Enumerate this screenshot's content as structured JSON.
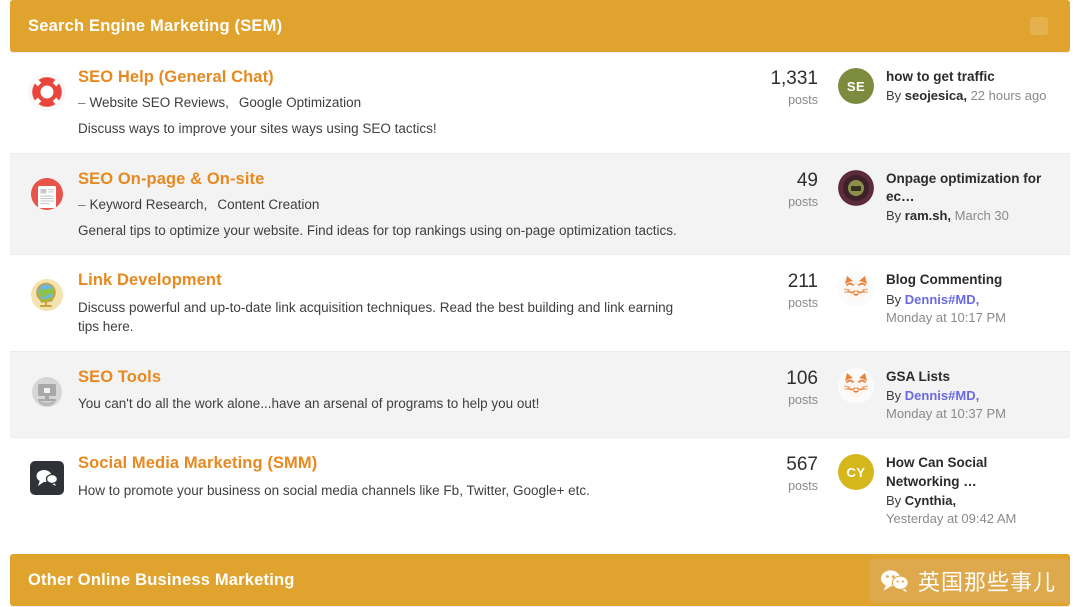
{
  "categories": [
    {
      "id": "sem",
      "title": "Search Engine Marketing (SEM)",
      "collapse_icon": "collapse-box-icon",
      "accent": "#e0a32e"
    },
    {
      "id": "other-online",
      "title": "Other Online Business Marketing",
      "collapse_icon": "collapse-box-icon",
      "accent": "#e0a32e"
    }
  ],
  "forums": [
    {
      "icon": "lifebuoy-icon",
      "title": "SEO Help (General Chat)",
      "dash": "–",
      "subforums": [
        "Website SEO Reviews,",
        "Google Optimization"
      ],
      "description": "Discuss ways to improve your sites ways using SEO tactics!",
      "count": "1,331",
      "count_label": "posts",
      "avatar": {
        "type": "initials",
        "text": "SE",
        "color": "#7d8b3f"
      },
      "last_title": "how to get traffic",
      "by_label": "By",
      "author": "seojesica,",
      "author_is_link": false,
      "time": "22 hours ago",
      "time_on_new_line": false
    },
    {
      "icon": "document-circle-icon",
      "title": "SEO On-page & On-site",
      "dash": "–",
      "subforums": [
        "Keyword Research,",
        "Content Creation"
      ],
      "description": "General tips to optimize your website. Find ideas for top rankings using on-page optimization tactics.",
      "count": "49",
      "count_label": "posts",
      "avatar": {
        "type": "badge",
        "text": "",
        "color": "#5b2c3a"
      },
      "last_title": "Onpage optimization for ec…",
      "by_label": "By",
      "author": "ram.sh,",
      "author_is_link": false,
      "time": "March 30",
      "time_on_new_line": false
    },
    {
      "icon": "globe-icon",
      "title": "Link Development",
      "dash": "",
      "subforums": [],
      "description": "Discuss powerful and up-to-date link acquisition techniques. Read the best building and link earning tips here.",
      "count": "211",
      "count_label": "posts",
      "avatar": {
        "type": "cat",
        "text": "",
        "color": "#f2f2f2"
      },
      "last_title": "Blog Commenting",
      "by_label": "By",
      "author": "Dennis#MD,",
      "author_is_link": true,
      "time": "Monday at 10:17 PM",
      "time_on_new_line": true
    },
    {
      "icon": "monitor-icon",
      "title": "SEO Tools",
      "dash": "",
      "subforums": [],
      "description": "You can't do all the work alone...have an arsenal of programs to help you out!",
      "count": "106",
      "count_label": "posts",
      "avatar": {
        "type": "cat",
        "text": "",
        "color": "#f2f2f2"
      },
      "last_title": "GSA Lists",
      "by_label": "By",
      "author": "Dennis#MD,",
      "author_is_link": true,
      "time": "Monday at 10:37 PM",
      "time_on_new_line": true
    },
    {
      "icon": "speech-bubbles-icon",
      "title": "Social Media Marketing (SMM)",
      "dash": "",
      "subforums": [],
      "description": "How to promote your business on social media channels like Fb, Twitter, Google+ etc.",
      "count": "567",
      "count_label": "posts",
      "avatar": {
        "type": "initials",
        "text": "CY",
        "color": "#d4b81b"
      },
      "last_title": "How Can Social Networking …",
      "by_label": "By",
      "author": "Cynthia,",
      "author_is_link": false,
      "time": "Yesterday at 09:42 AM",
      "time_on_new_line": true
    }
  ],
  "watermark": {
    "text": "英国那些事儿",
    "icon": "wechat-icon",
    "bg": "#deaa4e"
  }
}
